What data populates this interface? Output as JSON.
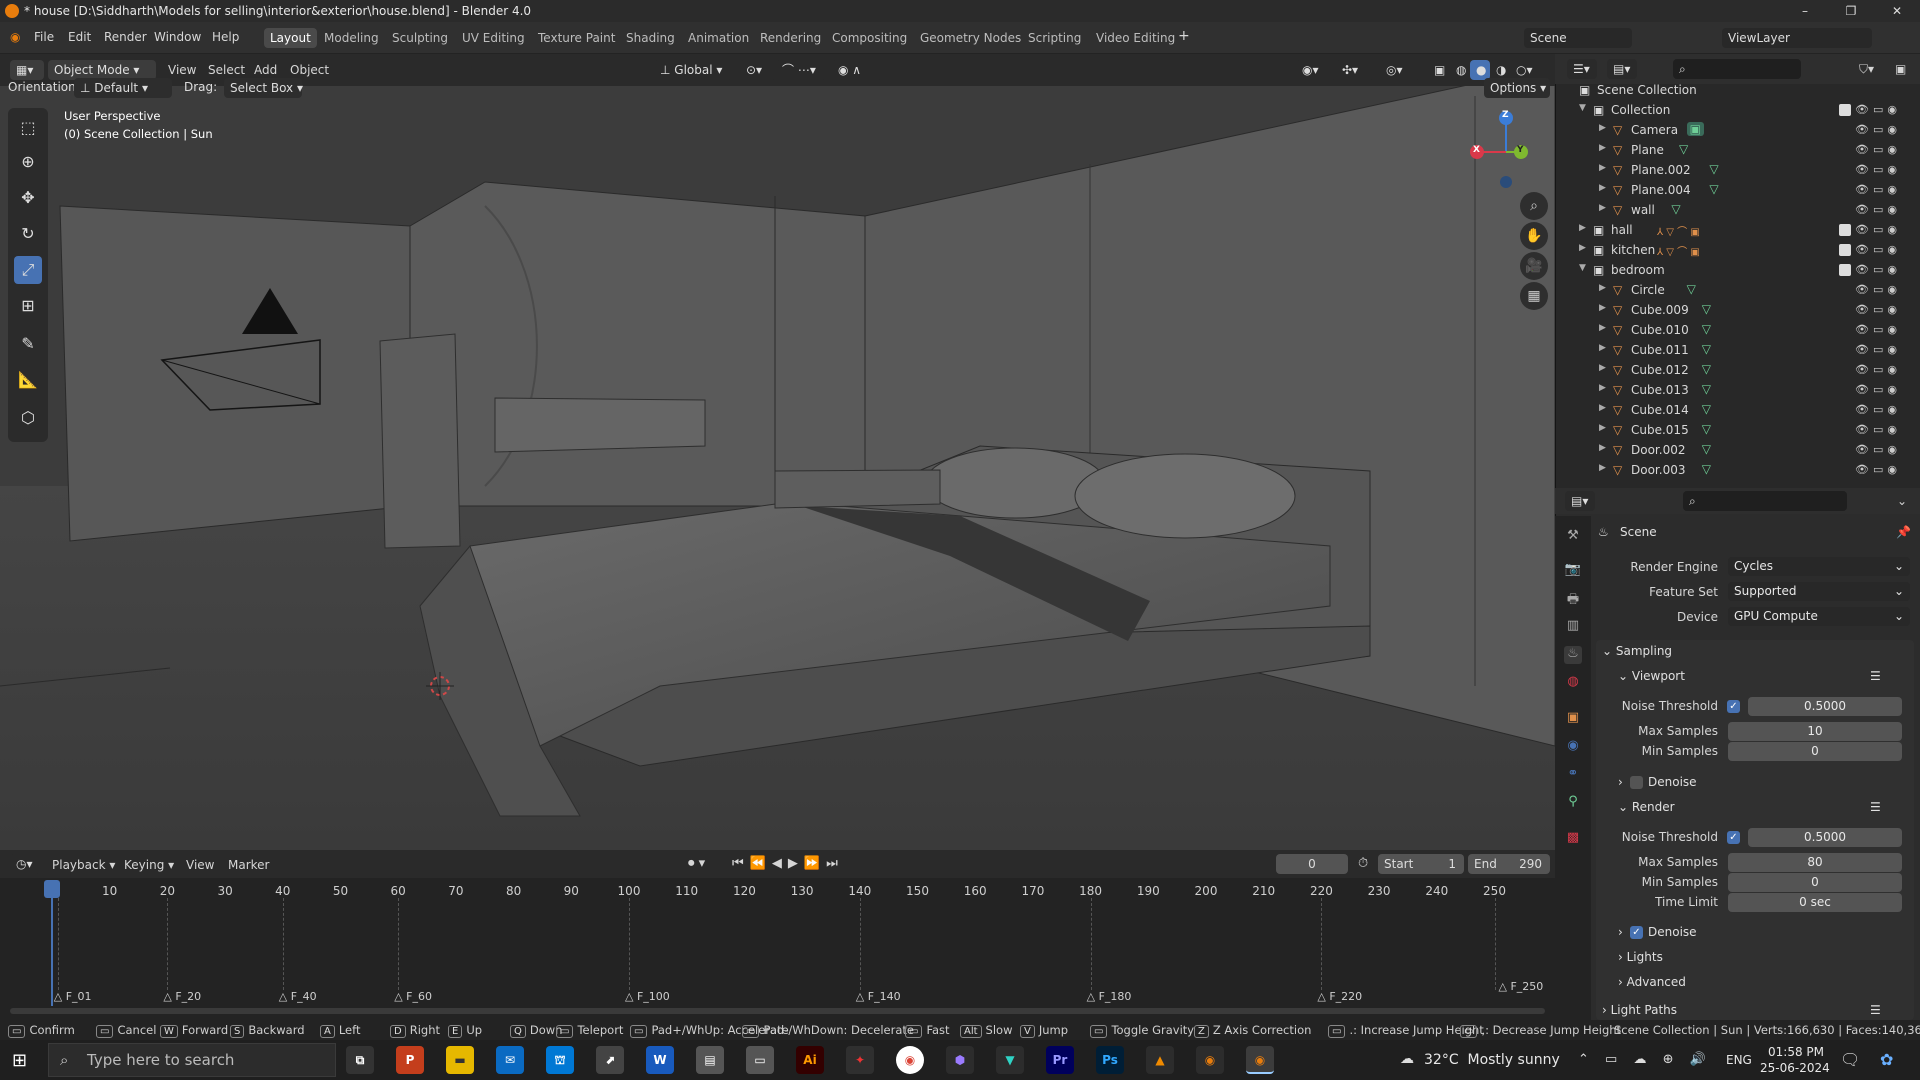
{
  "titlebar": {
    "title": "* house [D:\\Siddharth\\Models for selling\\interior&exterior\\house.blend] - Blender 4.0"
  },
  "menu": [
    "File",
    "Edit",
    "Render",
    "Window",
    "Help"
  ],
  "workspaces": [
    "Layout",
    "Modeling",
    "Sculpting",
    "UV Editing",
    "Texture Paint",
    "Shading",
    "Animation",
    "Rendering",
    "Compositing",
    "Geometry Nodes",
    "Scripting",
    "Video Editing"
  ],
  "scene_selector": "Scene",
  "view_layer": "ViewLayer",
  "viewport_header": {
    "mode": "Object Mode",
    "menus": [
      "View",
      "Select",
      "Add",
      "Object"
    ],
    "transform_orientation": "Global",
    "orientation_label": "Orientation:",
    "orientation_value": "Default",
    "drag_label": "Drag:",
    "drag_value": "Select Box",
    "options": "Options"
  },
  "viewport": {
    "perspective": "User Perspective",
    "context": "(0) Scene Collection | Sun"
  },
  "gizmo": {
    "x": "X",
    "y": "Y",
    "z": "Z"
  },
  "timeline": {
    "menus": [
      "Playback",
      "Keying",
      "View",
      "Marker"
    ],
    "current_frame": "0",
    "start_label": "Start",
    "start": "1",
    "end_label": "End",
    "end": "290",
    "ticks": [
      "0",
      "10",
      "20",
      "30",
      "40",
      "50",
      "60",
      "70",
      "80",
      "90",
      "100",
      "110",
      "120",
      "130",
      "140",
      "150",
      "160",
      "170",
      "180",
      "190",
      "200",
      "210",
      "220",
      "230",
      "240",
      "250"
    ],
    "markers": [
      "F_01",
      "F_20",
      "F_40",
      "F_60",
      "F_100",
      "F_140",
      "F_180",
      "F_220",
      "F_250"
    ]
  },
  "status_bar": {
    "hints": [
      {
        "key": "",
        "label": "Confirm"
      },
      {
        "key": "",
        "label": "Cancel"
      },
      {
        "key": "W",
        "label": "Forward"
      },
      {
        "key": "S",
        "label": "Backward"
      },
      {
        "key": "A",
        "label": "Left"
      },
      {
        "key": "D",
        "label": "Right"
      },
      {
        "key": "E",
        "label": "Up"
      },
      {
        "key": "Q",
        "label": "Down"
      },
      {
        "key": "",
        "label": "Teleport"
      },
      {
        "key": "",
        "label": "Pad+/WhUp: Accelerate"
      },
      {
        "key": "",
        "label": "Pad-/WhDown: Decelerate"
      },
      {
        "key": "",
        "label": "Fast"
      },
      {
        "key": "Alt",
        "label": "Slow"
      },
      {
        "key": "V",
        "label": "Jump"
      },
      {
        "key": "",
        "label": "Toggle Gravity"
      },
      {
        "key": "Z",
        "label": "Z Axis Correction"
      },
      {
        "key": "",
        "label": ".: Increase Jump Height"
      },
      {
        "key": "",
        "label": ",: Decrease Jump Height"
      }
    ],
    "stats": "Scene Collection | Sun | Verts:166,630 | Faces:140,361 | T"
  },
  "outliner": {
    "root": "Scene Collection",
    "rows": [
      {
        "name": "Collection",
        "kind": "collection",
        "depth": 0,
        "expanded": true
      },
      {
        "name": "Camera",
        "kind": "camera",
        "depth": 1
      },
      {
        "name": "Plane",
        "kind": "mesh",
        "depth": 1
      },
      {
        "name": "Plane.002",
        "kind": "mesh",
        "depth": 1
      },
      {
        "name": "Plane.004",
        "kind": "mesh",
        "depth": 1
      },
      {
        "name": "wall",
        "kind": "mesh",
        "depth": 1
      },
      {
        "name": "hall",
        "kind": "collection",
        "depth": 0,
        "expanded": false,
        "extra": "4 25 18 3"
      },
      {
        "name": "kitchen",
        "kind": "collection",
        "depth": 0,
        "expanded": false,
        "extra": "25"
      },
      {
        "name": "bedroom",
        "kind": "collection",
        "depth": 0,
        "expanded": true
      },
      {
        "name": "Circle",
        "kind": "mesh",
        "depth": 1
      },
      {
        "name": "Cube.009",
        "kind": "mesh",
        "depth": 1
      },
      {
        "name": "Cube.010",
        "kind": "mesh",
        "depth": 1
      },
      {
        "name": "Cube.011",
        "kind": "mesh",
        "depth": 1
      },
      {
        "name": "Cube.012",
        "kind": "mesh",
        "depth": 1
      },
      {
        "name": "Cube.013",
        "kind": "mesh",
        "depth": 1
      },
      {
        "name": "Cube.014",
        "kind": "mesh",
        "depth": 1
      },
      {
        "name": "Cube.015",
        "kind": "mesh",
        "depth": 1
      },
      {
        "name": "Door.002",
        "kind": "mesh",
        "depth": 1
      },
      {
        "name": "Door.003",
        "kind": "mesh",
        "depth": 1
      }
    ]
  },
  "properties": {
    "context": "Scene",
    "render_engine_label": "Render Engine",
    "render_engine": "Cycles",
    "feature_set_label": "Feature Set",
    "feature_set": "Supported",
    "device_label": "Device",
    "device": "GPU Compute",
    "sampling": "Sampling",
    "viewport": "Viewport",
    "noise_threshold_label": "Noise Threshold",
    "vp_noise_threshold": "0.5000",
    "max_samples_label": "Max Samples",
    "vp_max_samples": "10",
    "min_samples_label": "Min Samples",
    "vp_min_samples": "0",
    "denoise_label": "Denoise",
    "render": "Render",
    "r_noise_threshold": "0.5000",
    "r_max_samples": "80",
    "r_min_samples": "0",
    "time_limit_label": "Time Limit",
    "r_time_limit": "0 sec",
    "lights": "Lights",
    "advanced": "Advanced",
    "light_paths": "Light Paths"
  },
  "taskbar": {
    "search_placeholder": "Type here to search",
    "weather": "32°C  Mostly sunny",
    "lang": "ENG",
    "time": "01:58 PM",
    "date": "25-06-2024"
  }
}
